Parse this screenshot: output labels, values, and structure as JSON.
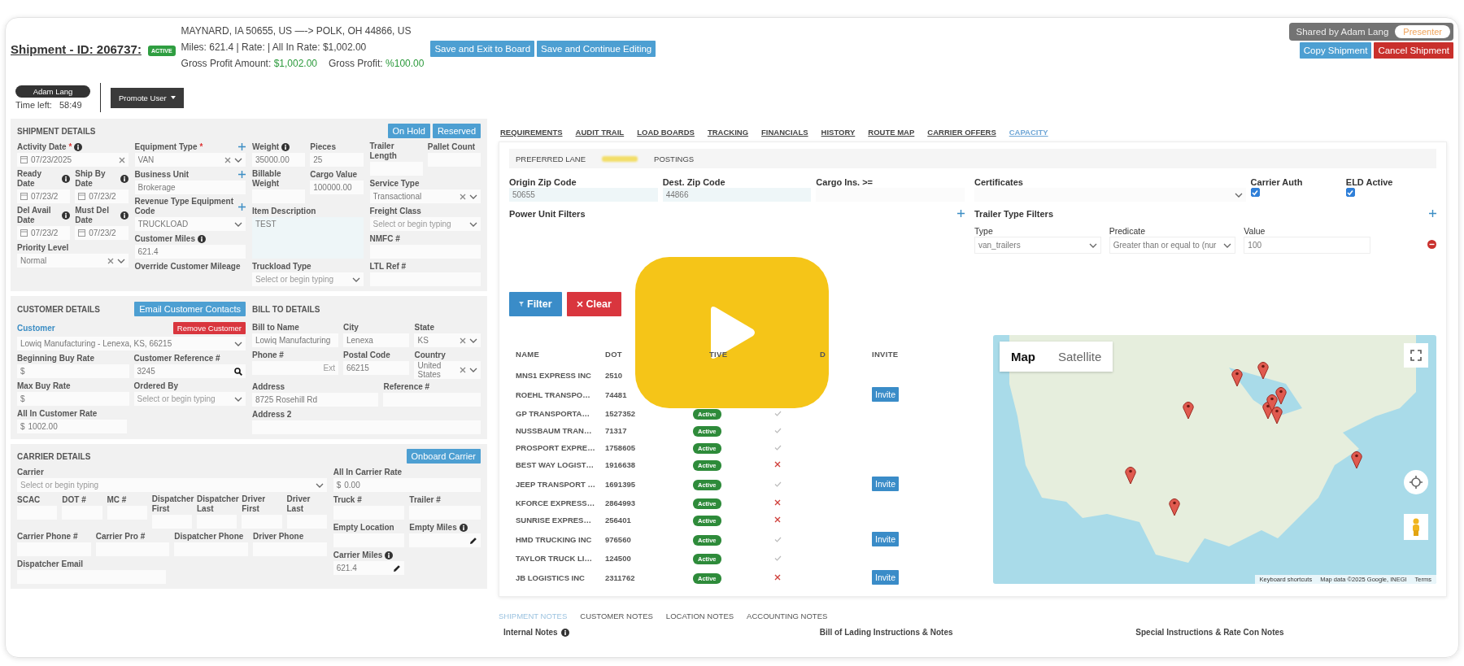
{
  "header": {
    "title": "Shipment - ID: 206737:",
    "status_badge": "ACTIVE",
    "route": "MAYNARD, IA 50655, US —-> POLK, OH 44866, US",
    "summary": "Miles: 621.4 | Rate: | All In Rate: $1,002.00",
    "profit": [
      {
        "label": "Gross Profit Amount:",
        "value": "$1,002.00"
      },
      {
        "label": "Gross Profit:",
        "value": "%100.00"
      }
    ],
    "buttons": [
      "Save and Exit to Board",
      "Save and Continue Editing"
    ],
    "share_banner": {
      "text": "Shared by Adam Lang",
      "role": "Presenter"
    },
    "actions": [
      {
        "label": "Copy Shipment",
        "kind": "primary"
      },
      {
        "label": "Cancel Shipment",
        "kind": "danger"
      }
    ],
    "user": {
      "name": "Adam Lang",
      "time_label": "Time left:",
      "time": "58:49"
    },
    "promote_button": "Promote User"
  },
  "shipment_details": {
    "title": "SHIPMENT DETAILS",
    "buttons": [
      "On Hold",
      "Reserved"
    ],
    "columns": [
      {
        "items": [
          {
            "label": "Activity Date",
            "required": "*",
            "info": true,
            "kind": "date",
            "value": "07/23/2025",
            "clearable": true
          },
          {
            "row": [
              {
                "label": "Ready Date",
                "info": true,
                "kind": "date",
                "value": "07/23/2"
              },
              {
                "label": "Ship By Date",
                "info": true,
                "kind": "date",
                "value": "07/23/2"
              }
            ]
          },
          {
            "row": [
              {
                "label": "Del Avail Date",
                "info": true,
                "kind": "date",
                "value": "07/23/2"
              },
              {
                "label": "Must Del Date",
                "info": true,
                "kind": "date",
                "value": "07/23/2"
              }
            ]
          },
          {
            "label": "Priority Level",
            "kind": "select",
            "value": "Normal",
            "clearable": true
          }
        ]
      },
      {
        "items": [
          {
            "label": "Equipment Type",
            "required": "*",
            "add": true,
            "kind": "select",
            "value": "VAN",
            "clearable": true
          },
          {
            "label": "Business Unit",
            "add": true,
            "kind": "text",
            "value": "Brokerage"
          },
          {
            "label": "Revenue Type Equipment Code",
            "add": true,
            "kind": "select",
            "value": "TRUCKLOAD"
          },
          {
            "label": "Customer Miles",
            "info": true,
            "kind": "text",
            "value": "621.4"
          },
          {
            "label": "Override Customer Mileage"
          }
        ]
      },
      {
        "items": [
          {
            "row": [
              {
                "label": "Weight",
                "info": true,
                "kind": "text",
                "value": "35000.00"
              },
              {
                "label": "Pieces",
                "kind": "text",
                "value": "25"
              }
            ]
          },
          {
            "row": [
              {
                "label": "Billable Weight",
                "kind": "text"
              },
              {
                "label": "Cargo Value",
                "kind": "text",
                "value": "100000.00"
              }
            ]
          },
          {
            "label": "Item Description",
            "kind": "textarea",
            "value": "TEST"
          },
          {
            "label": "Truckload Type",
            "kind": "select",
            "placeholder": "Select or begin typing"
          }
        ]
      },
      {
        "items": [
          {
            "row": [
              {
                "label": "Trailer Length",
                "kind": "text"
              },
              {
                "label": "Pallet Count",
                "kind": "text"
              }
            ]
          },
          {
            "label": "Service Type",
            "kind": "select",
            "value": "Transactional",
            "clearable": true
          },
          {
            "label": "Freight Class",
            "kind": "select",
            "placeholder": "Select or begin typing"
          },
          {
            "label": "NMFC #",
            "kind": "text"
          },
          {
            "label": "LTL Ref #",
            "kind": "text"
          }
        ]
      }
    ]
  },
  "customer_details": {
    "columns": [
      {
        "heading": "CUSTOMER DETAILS",
        "heading_button": "Email Customer Contacts",
        "items": [
          {
            "kind": "link",
            "label": "Customer",
            "button": "Remove Customer"
          },
          {
            "kind": "select",
            "value": "Lowiq Manufacturing - Lenexa, KS, 66215"
          },
          {
            "row": [
              {
                "label": "Beginning Buy Rate",
                "kind": "text",
                "prefix": "$"
              },
              {
                "label": "Customer Reference #",
                "kind": "lookup",
                "value": "3245"
              }
            ]
          },
          {
            "row": [
              {
                "label": "Max Buy Rate",
                "kind": "text",
                "prefix": "$"
              },
              {
                "label": "Ordered By",
                "kind": "select",
                "placeholder": "Select or begin typing"
              }
            ]
          },
          {
            "row": [
              {
                "label": "All In Customer Rate",
                "kind": "text",
                "prefix": "$",
                "value": "1002.00"
              }
            ]
          }
        ]
      },
      {
        "heading": "BILL TO DETAILS",
        "items": [
          {
            "row": [
              {
                "label": "Bill to Name",
                "kind": "text",
                "value": "Lowiq Manufacturing"
              },
              {
                "label": "City",
                "kind": "text",
                "value": "Lenexa"
              },
              {
                "label": "State",
                "kind": "select",
                "value": "KS",
                "clearable": true
              }
            ]
          },
          {
            "row": [
              {
                "label": "Phone #",
                "kind": "text",
                "suffix": "Ext"
              },
              {
                "label": "Postal Code",
                "kind": "text",
                "value": "66215"
              },
              {
                "label": "Country",
                "kind": "select",
                "value": "United States",
                "clearable": true
              }
            ]
          },
          {
            "row": [
              {
                "label": "Address",
                "kind": "text",
                "value": "8725 Rosehill Rd"
              },
              {
                "label": "Reference #",
                "kind": "text"
              }
            ]
          },
          {
            "row": [
              {
                "label": "Address 2",
                "kind": "text"
              }
            ]
          }
        ]
      }
    ]
  },
  "carrier_details": {
    "title": "CARRIER DETAILS",
    "buttons": [
      "Onboard Carrier"
    ],
    "columns": [
      {
        "items": [
          {
            "label": "Carrier",
            "kind": "select",
            "placeholder": "Select or begin typing"
          },
          {
            "row": [
              {
                "label": "SCAC",
                "kind": "text"
              },
              {
                "label": "DOT #",
                "kind": "text"
              },
              {
                "label": "MC #",
                "kind": "text"
              },
              {
                "label": "Dispatcher First",
                "kind": "text"
              },
              {
                "label": "Dispatcher Last",
                "kind": "text"
              },
              {
                "label": "Driver First",
                "kind": "text"
              },
              {
                "label": "Driver Last",
                "kind": "text"
              }
            ]
          },
          {
            "row": [
              {
                "label": "Carrier Phone #",
                "kind": "text"
              },
              {
                "label": "Carrier Pro #",
                "kind": "text"
              },
              {
                "label": "Dispatcher Phone",
                "kind": "text"
              },
              {
                "label": "Driver Phone",
                "kind": "text"
              }
            ]
          },
          {
            "row": [
              {
                "label": "Dispatcher Email",
                "kind": "text"
              }
            ]
          }
        ]
      },
      {
        "items": [
          {
            "label": "All In Carrier Rate",
            "kind": "text",
            "prefix": "$",
            "value": "0.00"
          },
          {
            "row": [
              {
                "label": "Truck #",
                "kind": "text"
              },
              {
                "label": "Trailer #",
                "kind": "text"
              }
            ]
          },
          {
            "row": [
              {
                "label": "Empty Location",
                "kind": "text"
              },
              {
                "label": "Empty Miles",
                "info": true,
                "kind": "editable"
              }
            ]
          },
          {
            "row": [
              {
                "label": "Carrier Miles",
                "info": true,
                "kind": "editable",
                "value": "621.4"
              }
            ]
          }
        ]
      }
    ]
  },
  "tabs": [
    {
      "label": "REQUIREMENTS",
      "selected": false
    },
    {
      "label": "AUDIT TRAIL",
      "selected": false
    },
    {
      "label": "LOAD BOARDS",
      "selected": false
    },
    {
      "label": "TRACKING",
      "selected": false
    },
    {
      "label": "FINANCIALS",
      "selected": false
    },
    {
      "label": "HISTORY",
      "selected": false
    },
    {
      "label": "ROUTE MAP",
      "selected": false
    },
    {
      "label": "CARRIER OFFERS",
      "selected": false
    },
    {
      "label": "CAPACITY",
      "selected": true
    }
  ],
  "capacity": {
    "subtabs": [
      {
        "label": "PREFERRED LANE",
        "selected": false
      },
      {
        "selected": true
      },
      {
        "label": "POSTINGS",
        "selected": false
      }
    ],
    "lane_fields": [
      {
        "label": "Origin Zip Code",
        "kind": "text",
        "value": "50655"
      },
      {
        "label": "Dest. Zip Code",
        "kind": "text",
        "value": "44866"
      },
      {
        "label": "Cargo Ins. >=",
        "kind": "text"
      }
    ],
    "power_unit": {
      "label": "Power Unit Filters",
      "add": true
    },
    "auth_fields": [
      {
        "label": "Certificates",
        "kind": "select"
      },
      {
        "label": "Carrier Auth",
        "kind": "checkbox",
        "checked": true
      },
      {
        "label": "ELD Active",
        "kind": "checkbox",
        "checked": true
      }
    ],
    "trailer_type": {
      "label": "Trailer Type Filters",
      "add": true
    },
    "trailer_filter": [
      {
        "label": "Type",
        "kind": "select",
        "value": "van_trailers"
      },
      {
        "label": "Predicate",
        "kind": "select",
        "value": "Greater than or equal to (nur"
      },
      {
        "label": "Value",
        "kind": "text",
        "value": "100"
      }
    ],
    "filter_button": "Filter",
    "clear_button": "Clear",
    "table": {
      "columns": [
        "NAME",
        "DOT",
        "TIVE",
        "D",
        "INVITE"
      ],
      "rows": [
        {
          "name": "MNS1 EXPRESS INC",
          "dot": "2510"
        },
        {
          "name": "ROEHL TRANSPO…",
          "dot": "74481",
          "invite": "Invite"
        },
        {
          "name": "GP TRANSPORTA…",
          "dot": "1527352",
          "status": "Active",
          "check": true
        },
        {
          "name": "NUSSBAUM TRAN…",
          "dot": "71317",
          "status": "Active",
          "check": true
        },
        {
          "name": "PROSPORT EXPRE…",
          "dot": "1758605",
          "status": "Active",
          "check": true
        },
        {
          "name": "BEST WAY LOGIST…",
          "dot": "1916638",
          "status": "Active",
          "check": false
        },
        {
          "name": "JEEP TRANSPORT …",
          "dot": "1691395",
          "status": "Active",
          "check": true,
          "invite": "Invite"
        },
        {
          "name": "KFORCE EXPRESS…",
          "dot": "2864993",
          "status": "Active",
          "check": false
        },
        {
          "name": "SUNRISE EXPRES…",
          "dot": "256401",
          "status": "Active",
          "check": false
        },
        {
          "name": "HMD TRUCKING INC",
          "dot": "976560",
          "status": "Active",
          "check": true,
          "invite": "Invite"
        },
        {
          "name": "TAYLOR TRUCK LI…",
          "dot": "124500",
          "status": "Active",
          "check": true
        },
        {
          "name": "JB LOGISTICS INC",
          "dot": "2311762",
          "status": "Active",
          "check": false,
          "invite": "Invite"
        }
      ]
    },
    "map": {
      "types": [
        {
          "label": "Map",
          "selected": true
        },
        {
          "label": "Satellite",
          "selected": false
        }
      ],
      "attribution": [
        "Keyboard shortcuts",
        "Map data ©2025 Google, INEGI",
        "Terms"
      ]
    }
  },
  "notes_tabs": [
    {
      "label": "SHIPMENT NOTES",
      "selected": true
    },
    {
      "label": "CUSTOMER NOTES",
      "selected": false
    },
    {
      "label": "LOCATION NOTES",
      "selected": false
    },
    {
      "label": "ACCOUNTING NOTES",
      "selected": false
    }
  ],
  "notes": [
    {
      "label": "Internal Notes",
      "info": true
    },
    {
      "label": "Bill of Lading Instructions & Notes"
    },
    {
      "label": "Special Instructions & Rate Con Notes"
    }
  ]
}
